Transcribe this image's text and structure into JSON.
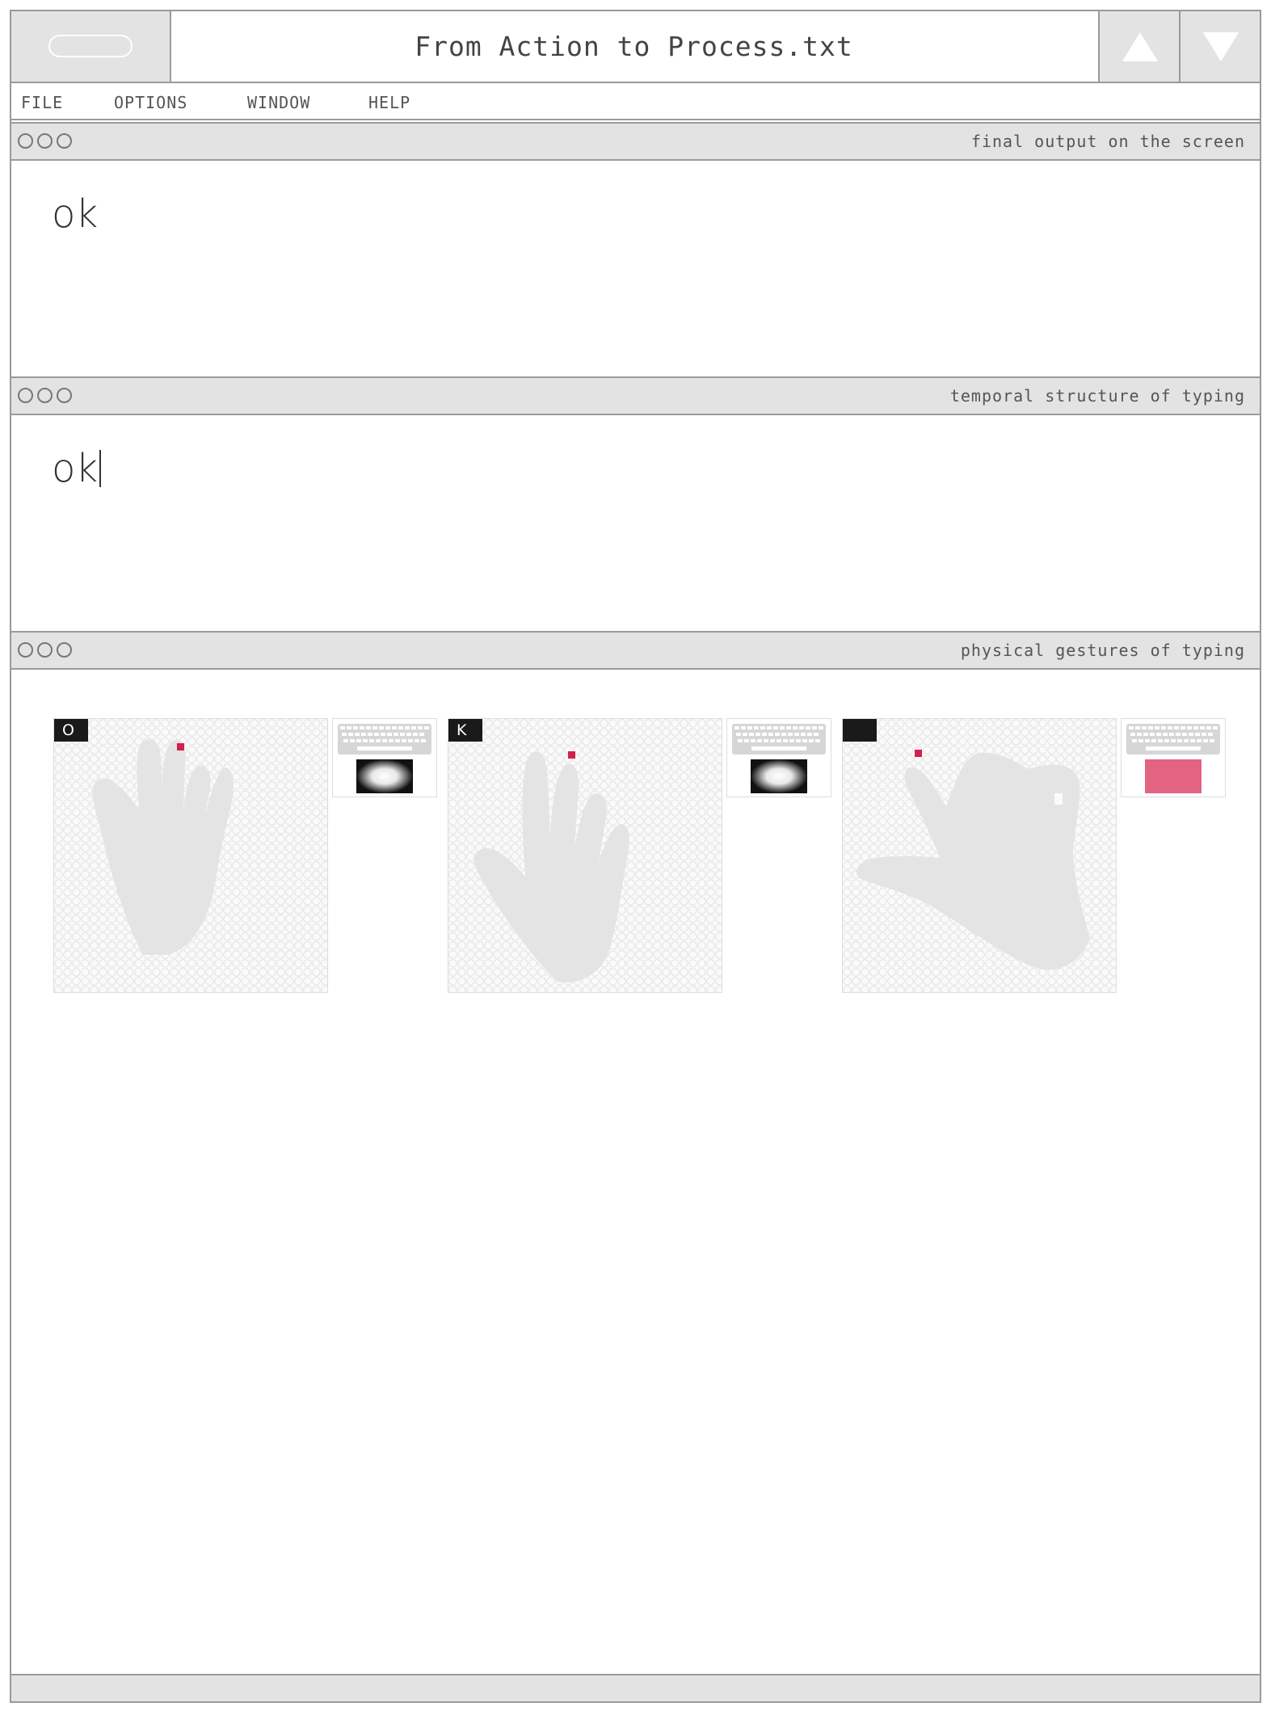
{
  "window": {
    "title": "From Action to Process.txt"
  },
  "menu": {
    "items": [
      "FILE",
      "OPTIONS",
      "WINDOW",
      "HELP"
    ]
  },
  "panels": {
    "output": {
      "label": "final output on the screen",
      "text": "ok"
    },
    "temporal": {
      "label": "temporal structure of typing",
      "text": "ok"
    },
    "gestures": {
      "label": "physical gestures of typing",
      "items": [
        {
          "key": "O",
          "indicator": "glow"
        },
        {
          "key": "K",
          "indicator": "glow"
        },
        {
          "key": "",
          "indicator": "pink"
        }
      ]
    }
  },
  "colors": {
    "frame": "#9a9a9a",
    "bar": "#e3e3e3",
    "hand": "#e4e4e4",
    "fingertip": "#d11f4e",
    "pink_block": "#e26482"
  }
}
